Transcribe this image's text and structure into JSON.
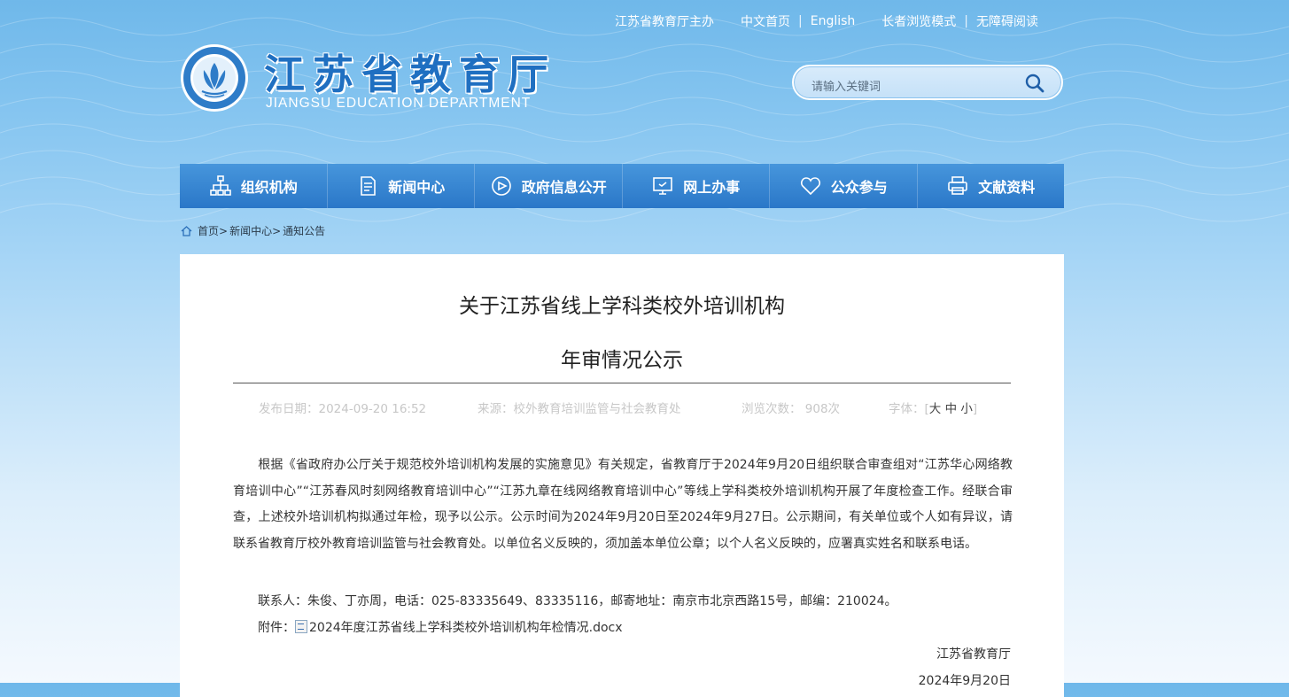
{
  "topbar": {
    "host": "江苏省教育厅主办",
    "home_cn": "中文首页",
    "english": "English",
    "elder_mode": "长者浏览模式",
    "accessible": "无障碍阅读",
    "sep": "|"
  },
  "site": {
    "title": "江苏省教育厅",
    "subtitle": "JIANGSU EDUCATION DEPARTMENT",
    "logo_icon": "education-emblem-icon"
  },
  "search": {
    "placeholder": "请输入关键词",
    "icon": "search-icon"
  },
  "nav": {
    "items": [
      {
        "label": "组织机构",
        "icon": "org-chart-icon"
      },
      {
        "label": "新闻中心",
        "icon": "document-icon"
      },
      {
        "label": "政府信息公开",
        "icon": "compass-icon"
      },
      {
        "label": "网上办事",
        "icon": "monitor-icon"
      },
      {
        "label": "公众参与",
        "icon": "heart-icon"
      },
      {
        "label": "文献资料",
        "icon": "printer-icon"
      }
    ]
  },
  "breadcrumb": {
    "home": "首页>",
    "news": "新闻中心>",
    "current": "通知公告",
    "icon": "home-icon"
  },
  "article": {
    "title_line1": "关于江苏省线上学科类校外培训机构",
    "title_line2": "年审情况公示",
    "meta": {
      "date": "发布日期：2024-09-20 16:52",
      "source": "来源：校外教育培训监管与社会教育处",
      "views": "浏览次数： 908次",
      "font_label": "字体：",
      "font_open": "[",
      "font_large": "大",
      "font_medium": "中",
      "font_small": "小",
      "font_close": "]"
    },
    "body": "根据《省政府办公厅关于规范校外培训机构发展的实施意见》有关规定，省教育厅于2024年9月20日组织联合审查组对“江苏华心网络教育培训中心”“江苏春风时刻网络教育培训中心”“江苏九章在线网络教育培训中心”等线上学科类校外培训机构开展了年度检查工作。经联合审查，上述校外培训机构拟通过年检，现予以公示。公示时间为2024年9月20日至2024年9月27日。公示期间，有关单位或个人如有异议，请联系省教育厅校外教育培训监管与社会教育处。以单位名义反映的，须加盖本单位公章；以个人名义反映的，应署真实姓名和联系电话。",
    "contact": "联系人：朱俊、丁亦周，电话：025-83335649、83335116，邮寄地址：南京市北京西路15号，邮编：210024。",
    "attachment_label": "附件：",
    "attachment_file": "2024年度江苏省线上学科类校外培训机构年检情况.docx",
    "attachment_icon": "doc-file-icon",
    "signature_org": "江苏省教育厅",
    "signature_date": "2024年9月20日"
  },
  "colors": {
    "nav_blue": "#2a77c8",
    "title_blue": "#1f6fc1",
    "sky_blue": "#86c5f0"
  }
}
